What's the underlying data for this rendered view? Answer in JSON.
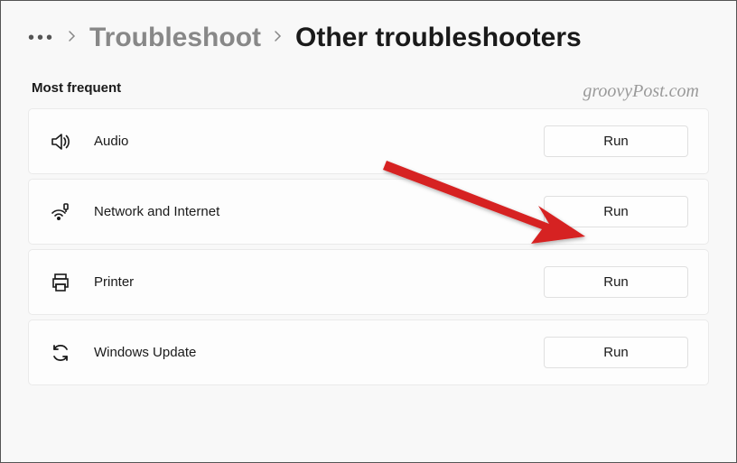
{
  "breadcrumb": {
    "parent": "Troubleshoot",
    "current": "Other troubleshooters"
  },
  "section_title": "Most frequent",
  "items": [
    {
      "icon": "speaker",
      "label": "Audio",
      "action": "Run"
    },
    {
      "icon": "wifi",
      "label": "Network and Internet",
      "action": "Run"
    },
    {
      "icon": "printer",
      "label": "Printer",
      "action": "Run"
    },
    {
      "icon": "refresh",
      "label": "Windows Update",
      "action": "Run"
    }
  ],
  "watermark": "groovyPost.com"
}
